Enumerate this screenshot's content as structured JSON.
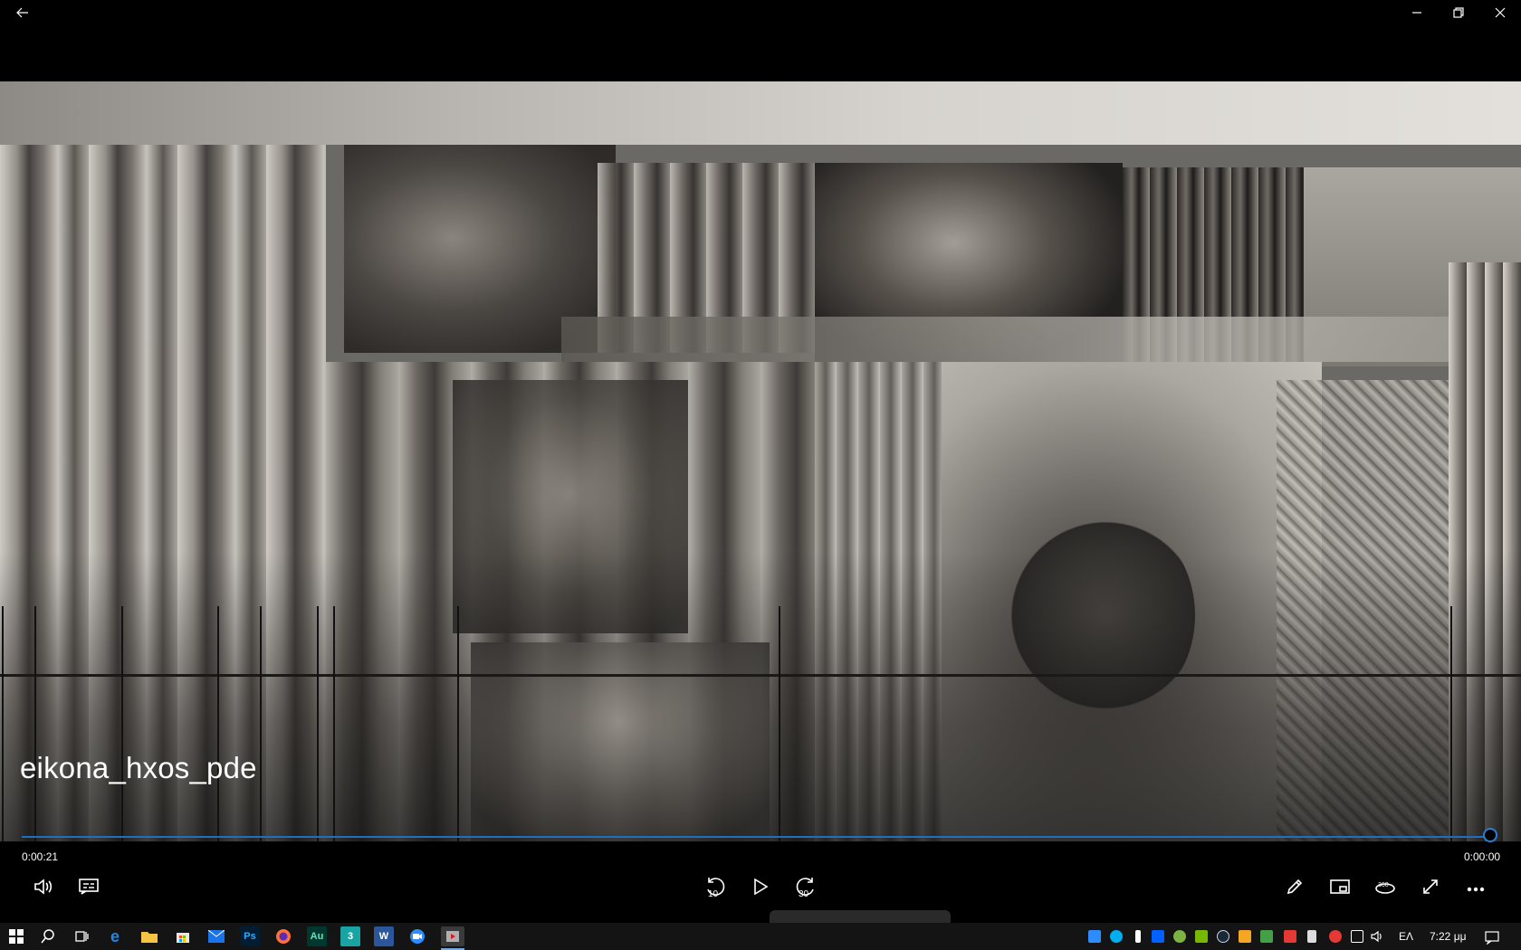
{
  "app": {
    "back_label": "←"
  },
  "media": {
    "title": "eikona_hxos_pde",
    "progress": 1.0,
    "elapsed": "0:00:21",
    "remaining": "0:00:00"
  },
  "controls": {
    "skip_back_label": "10",
    "skip_forward_label": "30",
    "view_360_label": "360°"
  },
  "taskbar": {
    "apps": [
      {
        "name": "start",
        "icon": "windows-logo-icon"
      },
      {
        "name": "search",
        "icon": "search-icon"
      },
      {
        "name": "task-view",
        "icon": "task-view-icon"
      },
      {
        "name": "edge",
        "icon": "edge-icon",
        "color": "#1e88e5"
      },
      {
        "name": "file-explorer",
        "icon": "folder-icon",
        "color": "#f6c343"
      },
      {
        "name": "store",
        "icon": "store-icon",
        "color": "#e8e8e8"
      },
      {
        "name": "mail",
        "icon": "mail-icon",
        "color": "#1a73e8"
      },
      {
        "name": "photoshop",
        "label": "Ps",
        "color": "#001d34",
        "fg": "#31a8ff"
      },
      {
        "name": "firefox",
        "icon": "firefox-icon",
        "color": "#ff7139"
      },
      {
        "name": "audition",
        "label": "Au",
        "color": "#00372f",
        "fg": "#5fe8b6"
      },
      {
        "name": "app-3",
        "label": "3",
        "color": "#1aa3a3"
      },
      {
        "name": "word",
        "label": "W",
        "color": "#2b579a"
      },
      {
        "name": "zoom",
        "icon": "zoom-icon",
        "color": "#2d8cff"
      },
      {
        "name": "movies-tv",
        "icon": "film-icon",
        "color": "#5a5a5a"
      }
    ],
    "language": "ΕΛ",
    "clock": "7:22 μμ"
  },
  "colors": {
    "accent": "#1f6fbf",
    "background": "#000000"
  }
}
